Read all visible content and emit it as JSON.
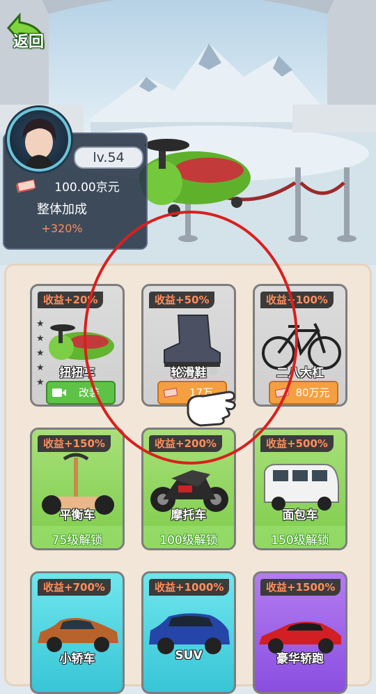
{
  "header": {
    "back_label": "返回"
  },
  "player": {
    "level": "lv.54",
    "money": "100.00京元",
    "bonus_title": "整体加成",
    "bonus_value": "+320%"
  },
  "vehicles": [
    {
      "name": "扭扭车",
      "bonus": "收益+20%",
      "state": "owned",
      "action_label": "改装",
      "action_icon": "video-icon",
      "stars": 5
    },
    {
      "name": "轮滑鞋",
      "bonus": "收益+50%",
      "state": "buy",
      "price": "17万0000元"
    },
    {
      "name": "二八大杠",
      "bonus": "收益+100%",
      "state": "buy",
      "price": "80万元"
    },
    {
      "name": "平衡车",
      "bonus": "收益+150%",
      "state": "locked",
      "unlock_text": "75级解锁"
    },
    {
      "name": "摩托车",
      "bonus": "收益+200%",
      "state": "locked",
      "unlock_text": "100级解锁"
    },
    {
      "name": "面包车",
      "bonus": "收益+500%",
      "state": "locked",
      "unlock_text": "150级解锁"
    },
    {
      "name": "小轿车",
      "bonus": "收益+700%",
      "state": "locked"
    },
    {
      "name": "SUV",
      "bonus": "收益+1000%",
      "state": "locked"
    },
    {
      "name": "豪华轿跑",
      "bonus": "收益+1500%",
      "state": "locked"
    }
  ],
  "colors": {
    "badge_text": "#ff8e5c",
    "tier_grey": "#d6d6d6",
    "tier_green": "#8fd65e",
    "tier_cyan": "#4fd2df",
    "tier_purple": "#9c62e6",
    "highlight_circle": "#d8201e"
  }
}
